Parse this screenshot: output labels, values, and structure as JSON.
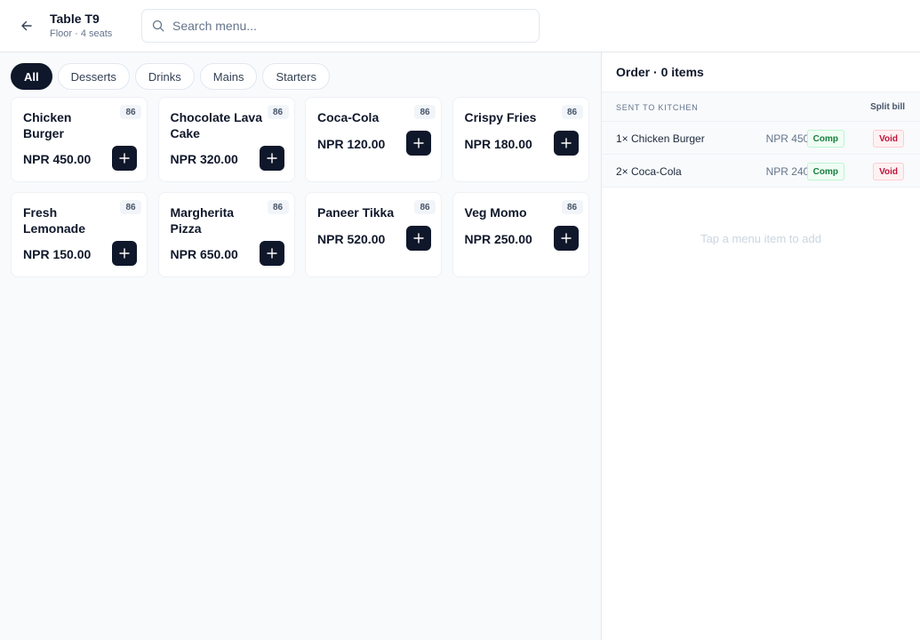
{
  "header": {
    "title": "Table T9",
    "subtitle": "Floor · 4 seats",
    "search_placeholder": "Search menu..."
  },
  "categories": [
    {
      "label": "All",
      "active": true
    },
    {
      "label": "Desserts",
      "active": false
    },
    {
      "label": "Drinks",
      "active": false
    },
    {
      "label": "Mains",
      "active": false
    },
    {
      "label": "Starters",
      "active": false
    }
  ],
  "menu_items": [
    {
      "name": "Chicken Burger",
      "price": "NPR 450.00",
      "badge": "86"
    },
    {
      "name": "Chocolate Lava Cake",
      "price": "NPR 320.00",
      "badge": "86"
    },
    {
      "name": "Coca-Cola",
      "price": "NPR 120.00",
      "badge": "86"
    },
    {
      "name": "Crispy Fries",
      "price": "NPR 180.00",
      "badge": "86"
    },
    {
      "name": "Fresh Lemonade",
      "price": "NPR 150.00",
      "badge": "86"
    },
    {
      "name": "Margherita Pizza",
      "price": "NPR 650.00",
      "badge": "86"
    },
    {
      "name": "Paneer Tikka",
      "price": "NPR 520.00",
      "badge": "86"
    },
    {
      "name": "Veg Momo",
      "price": "NPR 250.00",
      "badge": "86"
    }
  ],
  "add_button_symbol": "+",
  "order": {
    "title": "Order · 0 items",
    "section_label": "SENT TO KITCHEN",
    "split_bill_label": "Split bill",
    "lines": [
      {
        "qty_name": "1× Chicken Burger",
        "amount": "NPR 450.00",
        "comp_label": "Comp",
        "void_label": "Void"
      },
      {
        "qty_name": "2× Coca-Cola",
        "amount": "NPR 240.00",
        "comp_label": "Comp",
        "void_label": "Void"
      }
    ],
    "empty_hint": "Tap a menu item to add"
  },
  "icons": {
    "back": "arrow-left-icon",
    "search": "search-icon",
    "add": "plus-icon"
  },
  "colors": {
    "primary": "#0f172a",
    "comp": "#15803d",
    "void": "#be123c"
  }
}
